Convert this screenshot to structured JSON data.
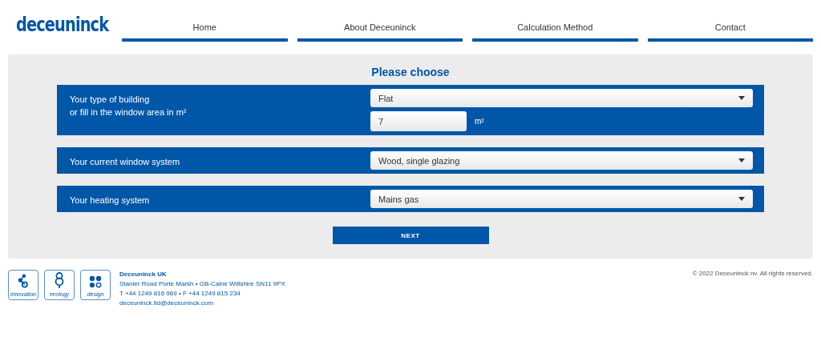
{
  "logo": "deceuninck",
  "nav": [
    {
      "label": "Home"
    },
    {
      "label": "About Deceuninck"
    },
    {
      "label": "Calculation Method"
    },
    {
      "label": "Contact"
    }
  ],
  "form": {
    "title": "Please choose",
    "rows": [
      {
        "label_lines": [
          "Your type of building",
          "or fill in the window area in m²"
        ],
        "select": "Flat",
        "area": {
          "value": "7",
          "unit": "m²"
        }
      },
      {
        "label_lines": [
          "Your current window system"
        ],
        "select": "Wood, single glazing"
      },
      {
        "label_lines": [
          "Your heating system"
        ],
        "select": "Mains gas"
      }
    ],
    "button": "NEXT"
  },
  "footer": {
    "badges": [
      {
        "kind": "innovation",
        "label": "innovation"
      },
      {
        "kind": "ecology",
        "label": "ecology"
      },
      {
        "kind": "design",
        "label": "design"
      }
    ],
    "company": "Deceuninck UK",
    "address": "Stanier Road Porte Marsh • GB-Calne Wiltshire SN11 9PX",
    "phone": "T +44 1249 816 969 • F +44 1249 815 234",
    "email": "deceuninck.ltd@deceuninck.com",
    "copyright": "© 2022 Deceuninck nv. All rights reserved."
  }
}
